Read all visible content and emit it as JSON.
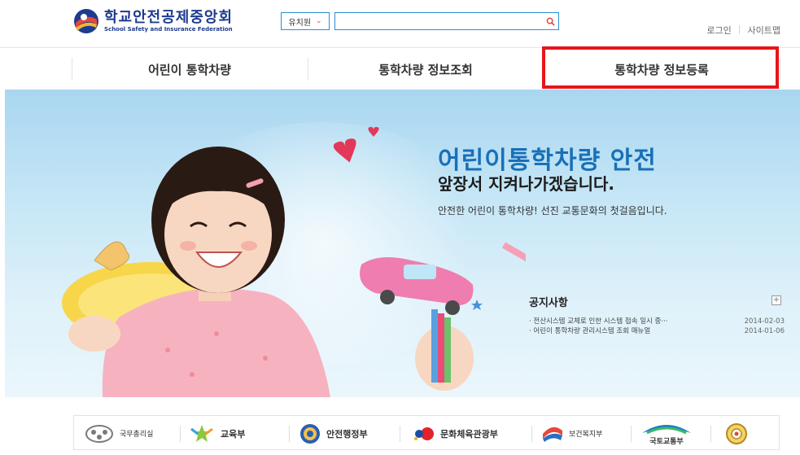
{
  "header": {
    "logo_title": "학교안전공제중앙회",
    "logo_subtitle": "School Safety and Insurance Federation",
    "search_select_value": "유치원",
    "search_placeholder": "",
    "login": "로그인",
    "sitemap": "사이트맵"
  },
  "nav": {
    "items": [
      {
        "label": "어린이 통학차량"
      },
      {
        "label": "통학차량 정보조회"
      },
      {
        "label": "통학차량 정보등록"
      }
    ]
  },
  "banner": {
    "headline": "어린이통학차량 안전",
    "subhead": "앞장서 지켜나가겠습니다.",
    "tagline": "안전한 어린이 통학차량! 선진 교통문화의 첫걸음입니다."
  },
  "notice": {
    "title": "공지사항",
    "more": "+",
    "items": [
      {
        "title": "· 전산시스템 교체로 인한 시스템 접속 일시 중···",
        "date": "2014-02-03"
      },
      {
        "title": "· 어린이 통학차량 관리시스템 조회 매뉴얼",
        "date": "2014-01-06"
      }
    ]
  },
  "footer": {
    "logos": [
      {
        "label": "국무총리실",
        "icon": "pmo-icon"
      },
      {
        "label": "교육부",
        "icon": "education-ministry-icon"
      },
      {
        "label": "안전행정부",
        "icon": "security-admin-icon"
      },
      {
        "label": "문화체육관광부",
        "icon": "culture-ministry-icon"
      },
      {
        "label": "보건복지부",
        "icon": "health-welfare-icon"
      },
      {
        "label": "국토교통부",
        "icon": "land-transport-icon"
      },
      {
        "label": "",
        "icon": "police-emblem-icon"
      }
    ]
  },
  "colors": {
    "brand_blue": "#1d3b8f",
    "headline_blue": "#1870b8",
    "highlight_red": "#e8141b",
    "search_border": "#2a8fd6"
  }
}
